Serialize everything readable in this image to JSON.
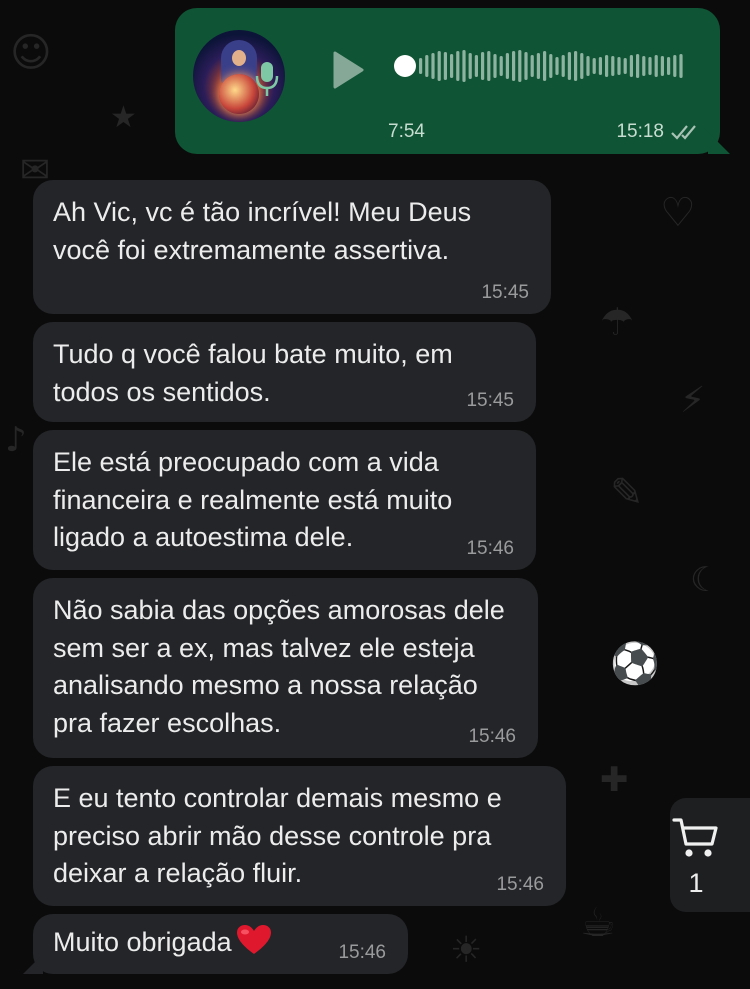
{
  "voice_message": {
    "duration": "7:54",
    "time": "15:18",
    "status": "read",
    "avatar_icon": "tarot-reader-avatar",
    "accent_color": "#0f5434"
  },
  "messages": [
    {
      "text": "Ah Vic, vc é tão incrível! Meu Deus você foi extremamente assertiva.",
      "time": "15:45"
    },
    {
      "text": "Tudo q você falou bate muito, em todos os sentidos.",
      "time": "15:45"
    },
    {
      "text": "Ele está preocupado com a vida financeira e realmente está muito ligado a autoestima dele.",
      "time": "15:46"
    },
    {
      "text": "Não sabia das opções amorosas dele sem ser a ex, mas talvez ele esteja analisando mesmo a nossa relação pra fazer escolhas.",
      "time": "15:46"
    },
    {
      "text": "E eu tento controlar demais mesmo e preciso abrir mão desse controle pra deixar a relação fluir.",
      "time": "15:46"
    },
    {
      "text": "Muito obrigada",
      "emoji": "heart",
      "time": "15:46"
    }
  ],
  "cart": {
    "count": "1",
    "icon": "cart-icon"
  }
}
